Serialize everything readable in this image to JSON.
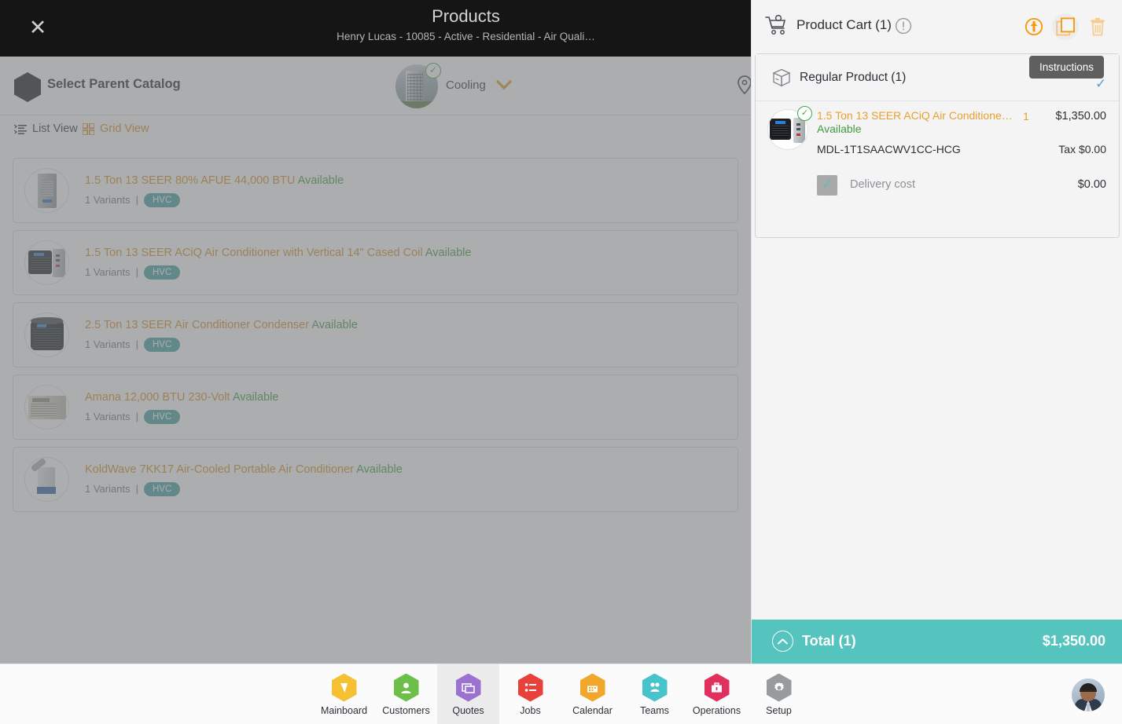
{
  "header": {
    "close_icon": "close-icon",
    "title": "Products",
    "subtitle": "Henry Lucas - 10085 - Active - Residential - Air Quali…",
    "panel_toggle_icon": "chevron-right-icon"
  },
  "catalog_bar": {
    "label": "Select Parent Catalog",
    "hex_icon": "hexagon-icon",
    "selected_catalog": "Cooling",
    "caret_icon": "chevron-down-icon",
    "check_badge": "check-circle-icon",
    "location_icon": "location-pin-icon"
  },
  "view_toggle": {
    "list_label": "List View",
    "list_icon": "list-view-icon",
    "grid_label": "Grid View",
    "grid_icon": "grid-view-icon",
    "active": "List View"
  },
  "products": [
    {
      "title": "1.5 Ton 13 SEER 80% AFUE 44,000 BTU",
      "status": "Available",
      "variants": "1 Variants",
      "separator": "|",
      "badge": "HVC",
      "art": "furnace"
    },
    {
      "title": "1.5 Ton 13 SEER ACiQ Air Conditioner with Vertical 14\" Cased Coil",
      "status": "Available",
      "variants": "1 Variants",
      "separator": "|",
      "badge": "HVC",
      "art": "cond-air"
    },
    {
      "title": "2.5 Ton 13 SEER Air Conditioner Condenser",
      "status": "Available",
      "variants": "1 Variants",
      "separator": "|",
      "badge": "HVC",
      "art": "round"
    },
    {
      "title": "Amana 12,000 BTU 230-Volt",
      "status": "Available",
      "variants": "1 Variants",
      "separator": "|",
      "badge": "HVC",
      "art": "window"
    },
    {
      "title": "KoldWave 7KK17 Air-Cooled Portable Air Conditioner",
      "status": "Available",
      "variants": "1 Variants",
      "separator": "|",
      "badge": "HVC",
      "art": "portable"
    }
  ],
  "cart": {
    "icon": "shopping-cart-icon",
    "title": "Product Cart (1)",
    "info_icon": "exclamation-circle-icon",
    "actions": [
      {
        "name": "upload-button",
        "icon": "upload-circle-icon"
      },
      {
        "name": "duplicate-button",
        "icon": "copy-icon"
      },
      {
        "name": "delete-button",
        "icon": "trash-icon"
      }
    ],
    "group_label": "Regular Product (1)",
    "group_icon": "package-box-icon",
    "tooltip": "Instructions",
    "check_icon": "check-icon",
    "item": {
      "name": "1.5 Ton 13 SEER ACiQ Air Conditione…",
      "status": "Available",
      "quantity": "1",
      "price": "$1,350.00",
      "model": "MDL-1T1SAACWV1CC-HCG",
      "tax": "Tax $0.00",
      "delivery_label": "Delivery cost",
      "delivery_amount": "$0.00",
      "delivery_checked": true,
      "check_badge": "check-circle-icon"
    },
    "total_label": "Total (1)",
    "total_amount": "$1,350.00",
    "total_caret_icon": "chevron-up-circle-icon"
  },
  "bottom_nav": {
    "items": [
      {
        "label": "Mainboard",
        "icon": "mainboard-icon",
        "color": "#f5c032",
        "active": false
      },
      {
        "label": "Customers",
        "icon": "user-icon",
        "color": "#6cc04a",
        "active": false
      },
      {
        "label": "Quotes",
        "icon": "quotes-icon",
        "color": "#9b72d0",
        "active": true
      },
      {
        "label": "Jobs",
        "icon": "list-icon",
        "color": "#e8403a",
        "active": false
      },
      {
        "label": "Calendar",
        "icon": "calendar-icon",
        "color": "#f0a72b",
        "active": false
      },
      {
        "label": "Teams",
        "icon": "teams-icon",
        "color": "#47c3cb",
        "active": false
      },
      {
        "label": "Operations",
        "icon": "briefcase-icon",
        "color": "#e12f5e",
        "active": false
      },
      {
        "label": "Setup",
        "icon": "gear-icon",
        "color": "#979b9e",
        "active": false
      }
    ],
    "avatar": "user-avatar"
  },
  "colors": {
    "accent_orange": "#d98b1f",
    "available_green": "#3f9a3f",
    "badge_teal": "#3f9fa0",
    "total_teal": "#55c4bf",
    "header_dark": "#151515"
  }
}
